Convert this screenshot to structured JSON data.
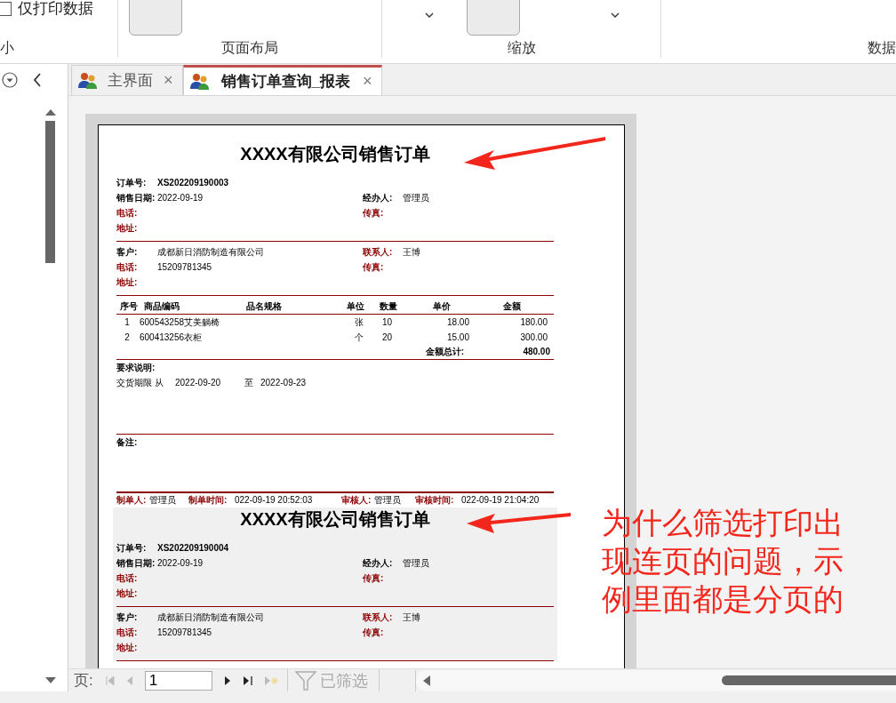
{
  "ribbon": {
    "print_data_only": {
      "label": "仅打印数据",
      "checked": false
    },
    "groups": [
      "小",
      "页面布局",
      "缩放",
      "数据"
    ]
  },
  "tabs": [
    {
      "label": "主界面",
      "selected": false,
      "close": "×"
    },
    {
      "label": "销售订单查询_报表",
      "selected": true,
      "close": "×"
    }
  ],
  "report": {
    "orders": [
      {
        "title": "XXXX有限公司销售订单",
        "shaded": false,
        "order_no": {
          "label": "订单号:",
          "value": "XS202209190003"
        },
        "info_rows": [
          [
            {
              "label": "销售日期:",
              "value": "2022-09-19",
              "color": "#000000"
            },
            {
              "label": "经办人:",
              "value": "管理员",
              "color": "#000000"
            }
          ],
          [
            {
              "label": "电话:",
              "color": "#8b0000"
            },
            {
              "label": "传真:",
              "color": "#8b0000"
            }
          ],
          [
            {
              "label": "地址:",
              "color": "#8b0000"
            }
          ]
        ],
        "customer_rows": [
          [
            {
              "label": "客户:",
              "value": "成都新日消防制造有限公司",
              "color": "#000000"
            },
            {
              "label": "联系人:",
              "value": "王博",
              "color": "#8b0000"
            }
          ],
          [
            {
              "label": "电话:",
              "value": "15209781345",
              "color": "#8b0000"
            },
            {
              "label": "传真:",
              "color": "#8b0000"
            }
          ],
          [
            {
              "label": "地址:",
              "color": "#8b0000"
            }
          ]
        ],
        "items": {
          "columns": [
            "序号",
            "商品编码",
            "品名规格",
            "单位",
            "数量",
            "单价",
            "金额"
          ],
          "rows": [
            {
              "no": "1",
              "product": "600543258艾美躺椅",
              "unit": "张",
              "qty": "10",
              "price": "18.00",
              "amount": "180.00"
            },
            {
              "no": "2",
              "product": "600413256衣柜",
              "unit": "个",
              "qty": "20",
              "price": "15.00",
              "amount": "300.00"
            }
          ],
          "total_label": "金额总计:",
          "total": "480.00"
        },
        "requirements": {
          "label": "要求说明:",
          "delivery_label": "交货期限 从",
          "from": "2022-09-20",
          "to_label": "至",
          "to": "2022-09-23"
        },
        "remarks_label": "备注:",
        "footer": [
          {
            "label": "制单人:",
            "value": "管理员"
          },
          {
            "label": "制单时间:",
            "value": "022-09-19 20:52:03"
          },
          {
            "label": "审核人:",
            "value": "管理员"
          },
          {
            "label": "审核时间:",
            "value": "022-09-19 21:04:20"
          }
        ]
      },
      {
        "title": "XXXX有限公司销售订单",
        "shaded": true,
        "order_no": {
          "label": "订单号:",
          "value": "XS202209190004"
        },
        "info_rows": [
          [
            {
              "label": "销售日期:",
              "value": "2022-09-19",
              "color": "#000000"
            },
            {
              "label": "经办人:",
              "value": "管理员",
              "color": "#000000"
            }
          ],
          [
            {
              "label": "电话:",
              "color": "#8b0000"
            },
            {
              "label": "传真:",
              "color": "#8b0000"
            }
          ],
          [
            {
              "label": "地址:",
              "color": "#8b0000"
            }
          ]
        ],
        "customer_rows": [
          [
            {
              "label": "客户:",
              "value": "成都新日消防制造有限公司",
              "color": "#000000"
            },
            {
              "label": "联系人:",
              "value": "王博",
              "color": "#8b0000"
            }
          ],
          [
            {
              "label": "电话:",
              "value": "15209781345",
              "color": "#8b0000"
            },
            {
              "label": "传真:",
              "color": "#8b0000"
            }
          ],
          [
            {
              "label": "地址:",
              "color": "#8b0000"
            }
          ]
        ]
      }
    ]
  },
  "record_nav": {
    "label": "页:",
    "page": "1",
    "filter": "已筛选"
  },
  "annotation": {
    "text": "为什么筛选打印出现连页的问题，示例里面都是分页的"
  }
}
